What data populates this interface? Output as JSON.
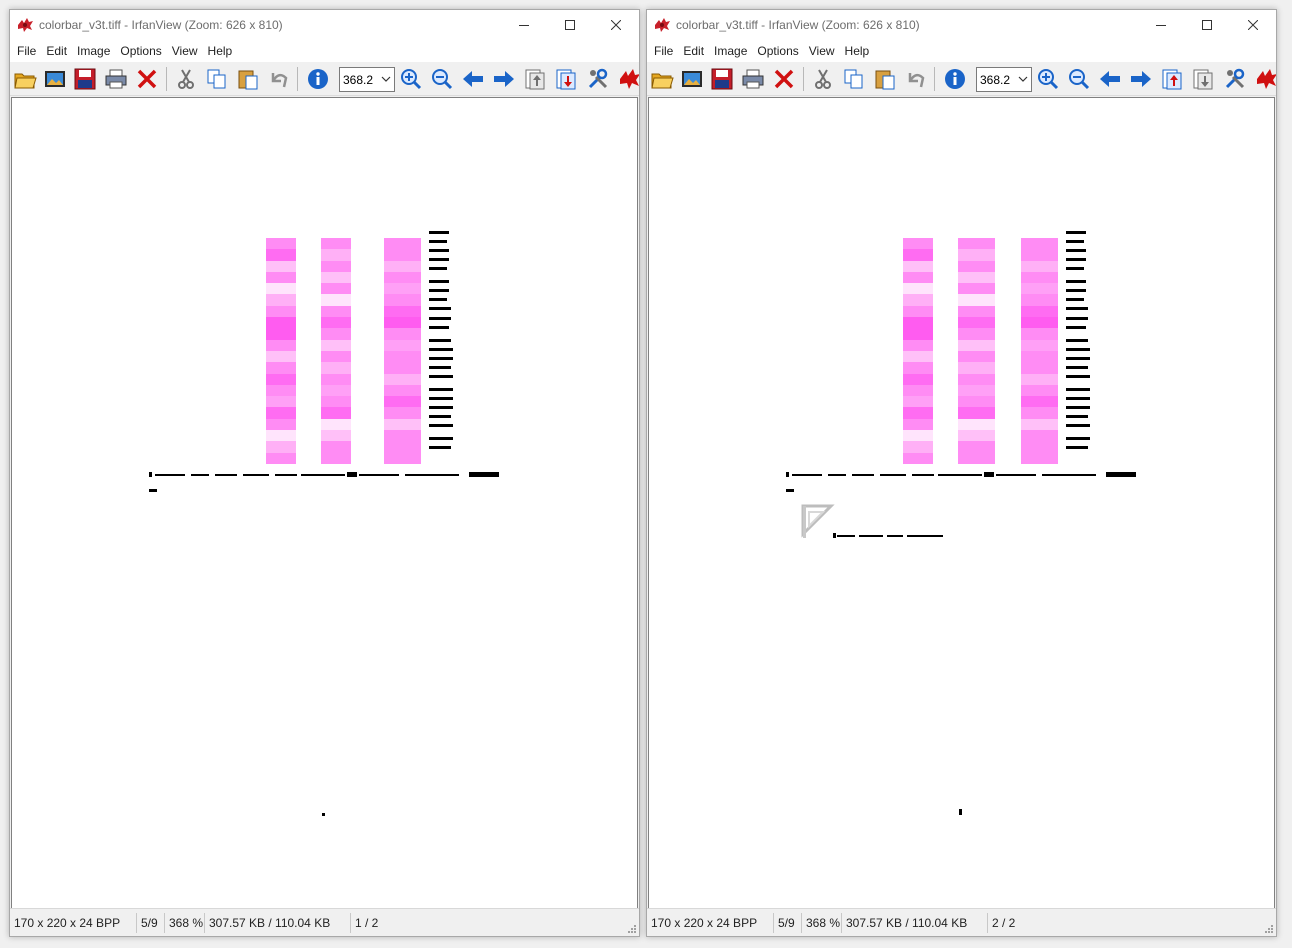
{
  "windows": [
    {
      "title": "colorbar_v3t.tiff - IrfanView (Zoom: 626 x 810)",
      "menu": [
        "File",
        "Edit",
        "Image",
        "Options",
        "View",
        "Help"
      ],
      "toolbar_icons": [
        "open-folder-icon",
        "thumbnails-icon",
        "save-icon",
        "print-icon",
        "delete-icon",
        "cut-icon",
        "copy-icon",
        "paste-icon",
        "undo-icon",
        "info-icon",
        "zoom-in-icon",
        "zoom-out-icon",
        "previous-icon",
        "next-icon",
        "previous-page-icon",
        "next-page-icon",
        "settings-icon",
        "irfanview-logo-icon"
      ],
      "zoom_value": "368.2",
      "status": {
        "dimensions": "170 x 220 x 24 BPP",
        "index": "5/9",
        "zoom": "368 %",
        "size": "307.57 KB / 110.04 KB",
        "page": "1 / 2"
      }
    },
    {
      "title": "colorbar_v3t.tiff - IrfanView (Zoom: 626 x 810)",
      "menu": [
        "File",
        "Edit",
        "Image",
        "Options",
        "View",
        "Help"
      ],
      "toolbar_icons": [
        "open-folder-icon",
        "thumbnails-icon",
        "save-icon",
        "print-icon",
        "delete-icon",
        "cut-icon",
        "copy-icon",
        "paste-icon",
        "undo-icon",
        "info-icon",
        "zoom-in-icon",
        "zoom-out-icon",
        "previous-icon",
        "next-icon",
        "previous-page-icon",
        "next-page-icon",
        "settings-icon",
        "irfanview-logo-icon"
      ],
      "zoom_value": "368.2",
      "status": {
        "dimensions": "170 x 220 x 24 BPP",
        "index": "5/9",
        "zoom": "368 %",
        "size": "307.57 KB / 110.04 KB",
        "page": "2 / 2"
      }
    }
  ],
  "colors": {
    "bar_light": "#ffc0f8",
    "bar_mid": "#ff8cf4",
    "bar_strong": "#ff5cf0",
    "bar_pale": "#ffe4fc",
    "ink": "#000000",
    "titlebar": "#ffffff",
    "close_red": "#e81123",
    "icon_blue": "#1a64c8"
  }
}
